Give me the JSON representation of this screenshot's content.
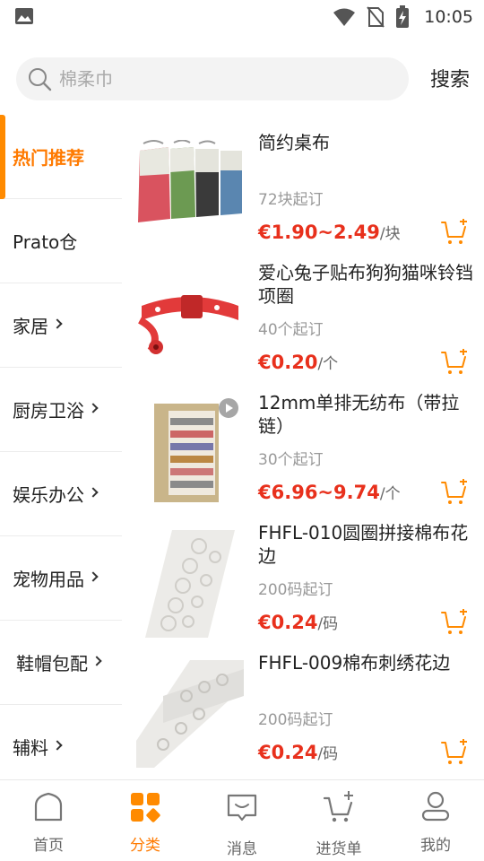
{
  "status_bar": {
    "time": "10:05",
    "icons": [
      "image-icon",
      "wifi-icon",
      "no-sim-icon",
      "battery-charging-icon"
    ]
  },
  "search": {
    "placeholder": "棉柔巾",
    "button_label": "搜索"
  },
  "sidebar": {
    "items": [
      {
        "label": "热门推荐",
        "active": true,
        "has_chevron": false
      },
      {
        "label": "Prato仓",
        "active": false,
        "has_chevron": false
      },
      {
        "label": "家居",
        "active": false,
        "has_chevron": true
      },
      {
        "label": "厨房卫浴",
        "active": false,
        "has_chevron": true
      },
      {
        "label": "娱乐办公",
        "active": false,
        "has_chevron": true
      },
      {
        "label": "宠物用品",
        "active": false,
        "has_chevron": true
      },
      {
        "label": "鞋帽包配",
        "active": false,
        "has_chevron": true
      },
      {
        "label": "辅料",
        "active": false,
        "has_chevron": true
      }
    ]
  },
  "products": [
    {
      "title": "简约桌布",
      "moq": "72块起订",
      "price": "€1.90~2.49",
      "unit": "/块",
      "image": "tablecloth-image"
    },
    {
      "title": "爱心兔子贴布狗狗猫咪铃铛项圈",
      "moq": "40个起订",
      "price": "€0.20",
      "unit": "/个",
      "image": "pet-collar-image"
    },
    {
      "title": "12mm单排无纺布（带拉链）",
      "moq": "30个起订",
      "price": "€6.96~9.74",
      "unit": "/个",
      "image": "shoe-rack-image",
      "has_video": true
    },
    {
      "title": "FHFL-010圆圈拼接棉布花边",
      "moq": "200码起订",
      "price": "€0.24",
      "unit": "/码",
      "image": "lace-trim-image"
    },
    {
      "title": "FHFL-009棉布刺绣花边",
      "moq": "200码起订",
      "price": "€0.24",
      "unit": "/码",
      "image": "embroidered-lace-image"
    }
  ],
  "bottom_nav": {
    "items": [
      {
        "label": "首页",
        "icon": "home-icon",
        "active": false
      },
      {
        "label": "分类",
        "icon": "category-icon",
        "active": true
      },
      {
        "label": "消息",
        "icon": "message-icon",
        "active": false
      },
      {
        "label": "进货单",
        "icon": "cart-icon",
        "active": false
      },
      {
        "label": "我的",
        "icon": "profile-icon",
        "active": false
      }
    ]
  },
  "colors": {
    "accent": "#ff7a00",
    "price": "#e8301c"
  }
}
